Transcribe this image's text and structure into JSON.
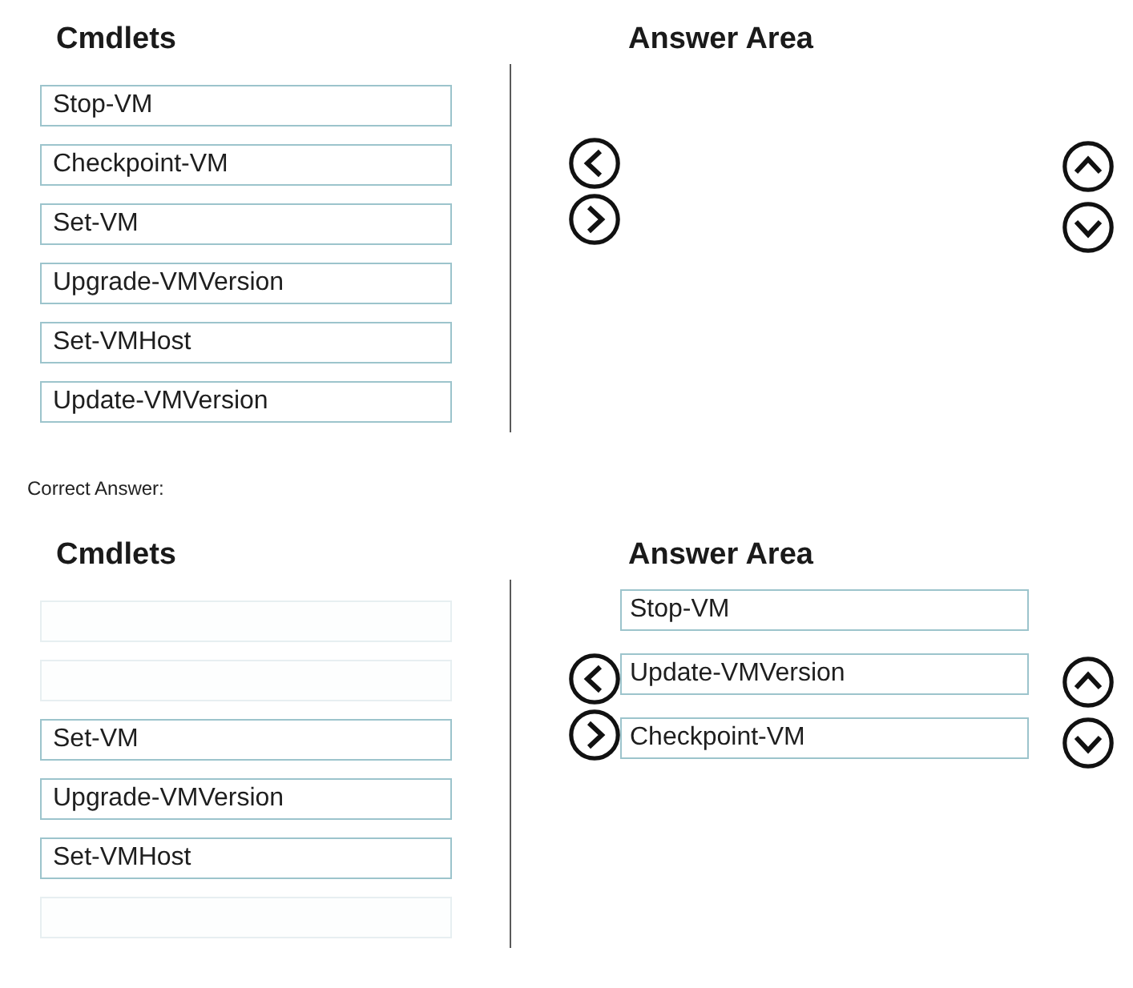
{
  "question_panel": {
    "cmdlets": {
      "title": "Cmdlets",
      "slots": [
        {
          "kind": "cmdlet",
          "label": "Stop-VM"
        },
        {
          "kind": "cmdlet",
          "label": "Checkpoint-VM"
        },
        {
          "kind": "cmdlet",
          "label": "Set-VM"
        },
        {
          "kind": "cmdlet",
          "label": "Upgrade-VMVersion"
        },
        {
          "kind": "cmdlet",
          "label": "Set-VMHost"
        },
        {
          "kind": "cmdlet",
          "label": "Update-VMVersion"
        }
      ]
    },
    "answer_area": {
      "title": "Answer Area"
    }
  },
  "correct_answer": {
    "label": "Correct Answer:",
    "panel": {
      "cmdlets": {
        "title": "Cmdlets",
        "slots": [
          {
            "kind": "empty"
          },
          {
            "kind": "empty"
          },
          {
            "kind": "cmdlet",
            "label": "Set-VM"
          },
          {
            "kind": "cmdlet",
            "label": "Upgrade-VMVersion"
          },
          {
            "kind": "cmdlet",
            "label": "Set-VMHost"
          },
          {
            "kind": "empty"
          }
        ]
      },
      "answer_area": {
        "title": "Answer Area",
        "items": [
          {
            "label": "Stop-VM"
          },
          {
            "label": "Update-VMVersion"
          },
          {
            "label": "Checkpoint-VM"
          }
        ]
      }
    }
  }
}
